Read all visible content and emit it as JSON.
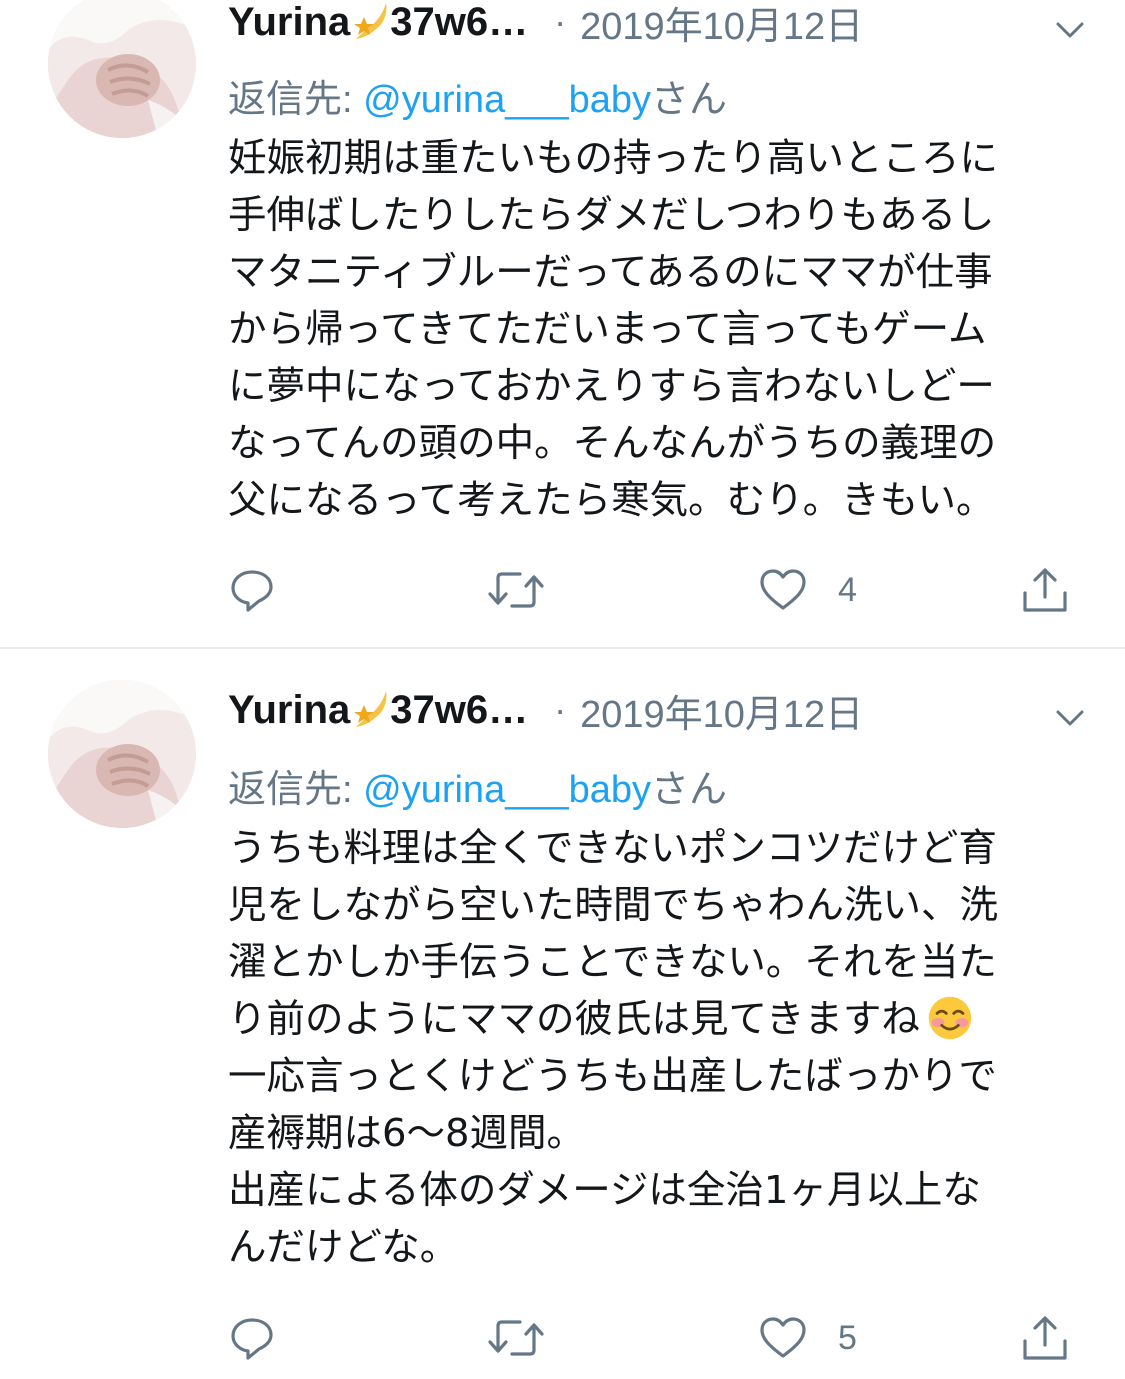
{
  "colors": {
    "text": "#14171a",
    "secondary": "#657786",
    "link": "#1da1f2",
    "divider": "#e6ecf0"
  },
  "tweets": [
    {
      "display_name": "Yurina",
      "name_emoji": "shooting-star-emoji",
      "name_suffix": "37w6…",
      "separator": "·",
      "date": "2019年10月12日",
      "reply_prefix": "返信先: ",
      "reply_handle": "@yurina___baby",
      "reply_suffix": "さん",
      "text": "妊娠初期は重たいもの持ったり高いところに\n手伸ばしたりしたらダメだしつわりもあるし\nマタニティブルーだってあるのにママが仕事\nから帰ってきてただいまって言ってもゲーム\nに夢中になっておかえりすら言わないしどー\nなってんの頭の中。そんなんがうちの義理の\n父になるって考えたら寒気。むり。きもい。",
      "text_emoji": "",
      "like_count": "4",
      "icons": [
        "reply-icon",
        "retweet-icon",
        "like-icon",
        "share-icon"
      ]
    },
    {
      "display_name": "Yurina",
      "name_emoji": "shooting-star-emoji",
      "name_suffix": "37w6…",
      "separator": "·",
      "date": "2019年10月12日",
      "reply_prefix": "返信先: ",
      "reply_handle": "@yurina___baby",
      "reply_suffix": "さん",
      "text": "うちも料理は全くできないポンコツだけど育\n児をしながら空いた時間でちゃわん洗い、洗\n濯とかしか手伝うことできない。それを当た\nり前のようにママの彼氏は見てきますね",
      "text_emoji": "smiling-face-emoji",
      "text_after_emoji": "\n一応言っとくけどうちも出産したばっかりで\n産褥期は6〜8週間。\n出産による体のダメージは全治1ヶ月以上な\nんだけどな。",
      "like_count": "5",
      "icons": [
        "reply-icon",
        "retweet-icon",
        "like-icon",
        "share-icon"
      ]
    }
  ]
}
